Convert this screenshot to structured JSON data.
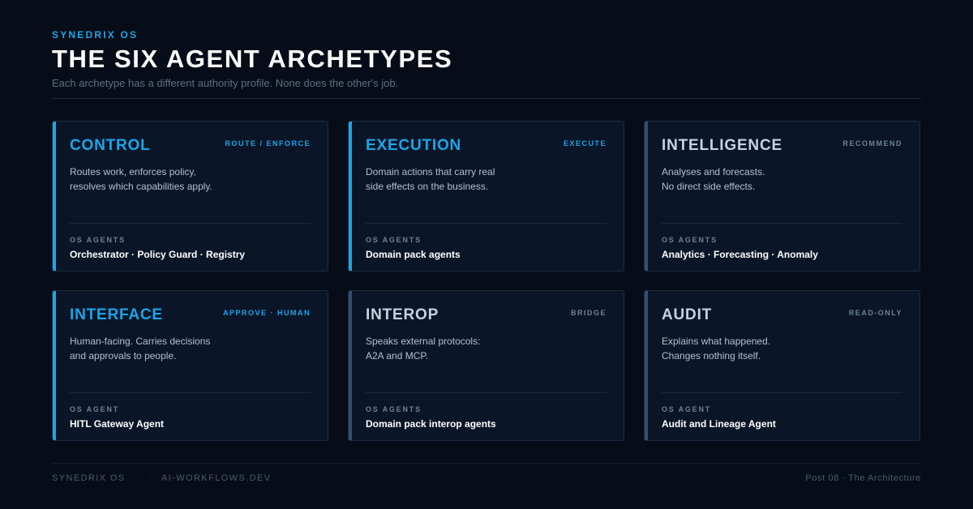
{
  "header": {
    "eyebrow": "SYNEDRIX OS",
    "title": "THE SIX AGENT ARCHETYPES",
    "subtitle": "Each archetype has a different authority profile. None does the other's job."
  },
  "colors": {
    "accent": "#1aa6e8",
    "background": "#070d18",
    "card": "#0a1628",
    "muted_bar": "#34506e"
  },
  "cards": [
    {
      "name": "CONTROL",
      "tag": "ROUTE / ENFORCE",
      "accent": true,
      "desc": [
        "Routes work, enforces policy,",
        "resolves which capabilities apply."
      ],
      "label": "OS AGENTS",
      "agents": "Orchestrator · Policy Guard · Registry"
    },
    {
      "name": "EXECUTION",
      "tag": "EXECUTE",
      "accent": true,
      "desc": [
        "Domain actions that carry real",
        "side effects on the business."
      ],
      "label": "OS AGENTS",
      "agents": "Domain pack agents"
    },
    {
      "name": "INTELLIGENCE",
      "tag": "RECOMMEND",
      "accent": false,
      "desc": [
        "Analyses and forecasts.",
        "No direct side effects."
      ],
      "label": "OS AGENTS",
      "agents": "Analytics · Forecasting · Anomaly"
    },
    {
      "name": "INTERFACE",
      "tag": "APPROVE · HUMAN",
      "accent": true,
      "desc": [
        "Human-facing. Carries decisions",
        "and approvals to people."
      ],
      "label": "OS AGENT",
      "agents": "HITL Gateway Agent"
    },
    {
      "name": "INTEROP",
      "tag": "BRIDGE",
      "accent": false,
      "desc": [
        "Speaks external protocols:",
        "A2A and MCP."
      ],
      "label": "OS AGENTS",
      "agents": "Domain pack interop agents"
    },
    {
      "name": "AUDIT",
      "tag": "READ-ONLY",
      "accent": false,
      "desc": [
        "Explains what happened.",
        "Changes nothing itself."
      ],
      "label": "OS AGENT",
      "agents": "Audit and Lineage Agent"
    }
  ],
  "footer": {
    "brand": "SYNEDRIX OS",
    "separator": "·",
    "site": "AI-WORKFLOWS.DEV",
    "post": "Post 08 · The Architecture"
  }
}
